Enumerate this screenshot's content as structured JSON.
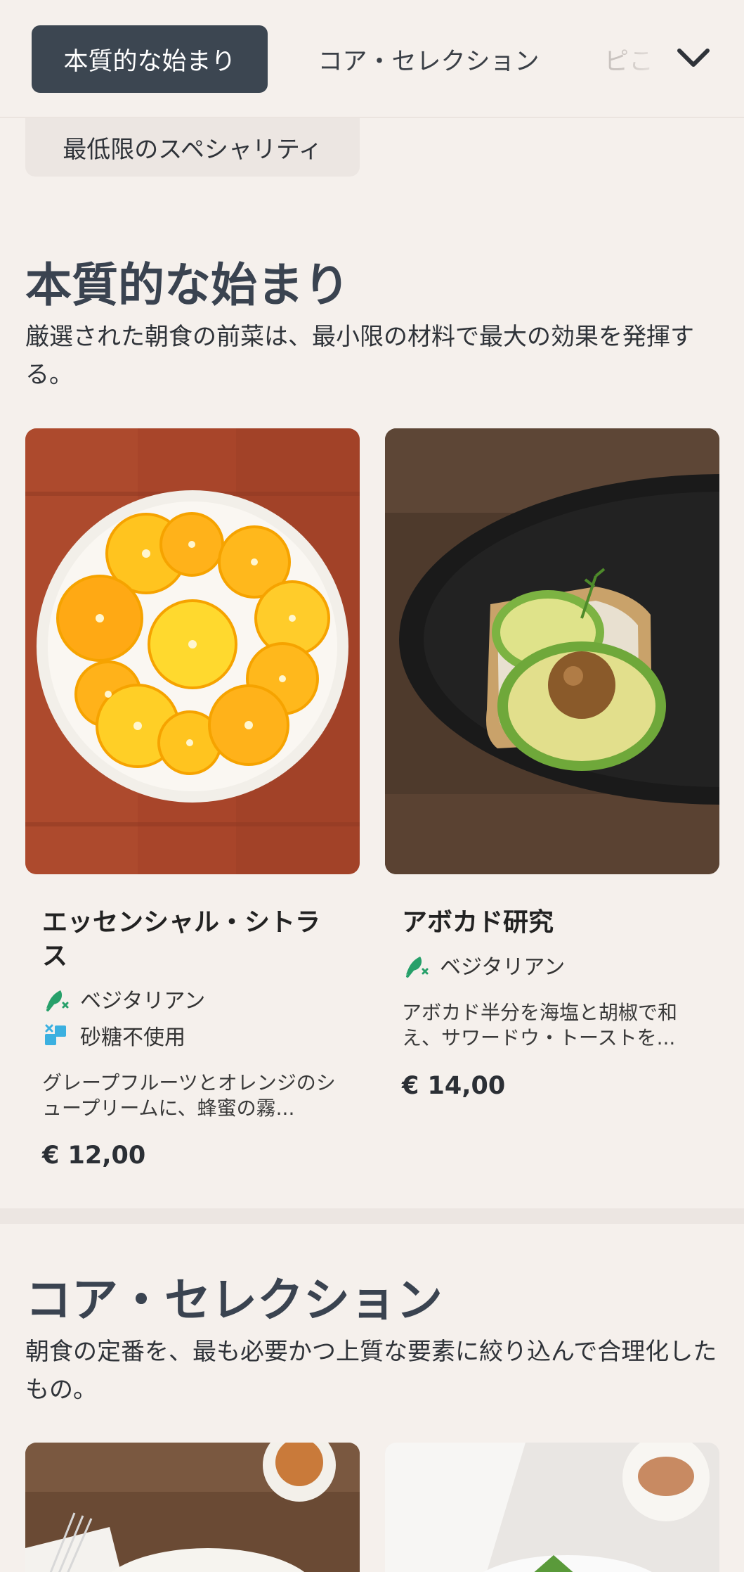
{
  "tabs": [
    {
      "label": "本質的な始まり",
      "active": true
    },
    {
      "label": "コア・セレクション",
      "active": false
    },
    {
      "label": "ピこ",
      "active": false
    }
  ],
  "chip": {
    "label": "最低限のスペシャリティ"
  },
  "sections": [
    {
      "title": "本質的な始まり",
      "description": "厳選された朝食の前菜は、最小限の材料で最大の効果を発揮する。",
      "items": [
        {
          "title": "エッセンシャル・シトラス",
          "tags": [
            "ベジタリアン",
            "砂糖不使用"
          ],
          "description": "グレープフルーツとオレンジのシュープリームに、蜂蜜の霧...",
          "price": "€ 12,00"
        },
        {
          "title": "アボカド研究",
          "tags": [
            "ベジタリアン"
          ],
          "description": "アボカド半分を海塩と胡椒で和え、サワードウ・トーストを...",
          "price": "€ 14,00"
        }
      ]
    },
    {
      "title": "コア・セレクション",
      "description": "朝食の定番を、最も必要かつ上質な要素に絞り込んで合理化したもの。"
    }
  ],
  "icons": {
    "vegetarian": "vegetarian-icon",
    "sugar_free": "sugar-free-icon",
    "menu_chevron": "chevron-down-icon"
  },
  "colors": {
    "background": "#f5f0ec",
    "active_tab": "#3c4651",
    "heading": "#3a4350",
    "vegetarian_green": "#27a06a",
    "sugar_free_blue": "#3bb0e0"
  }
}
